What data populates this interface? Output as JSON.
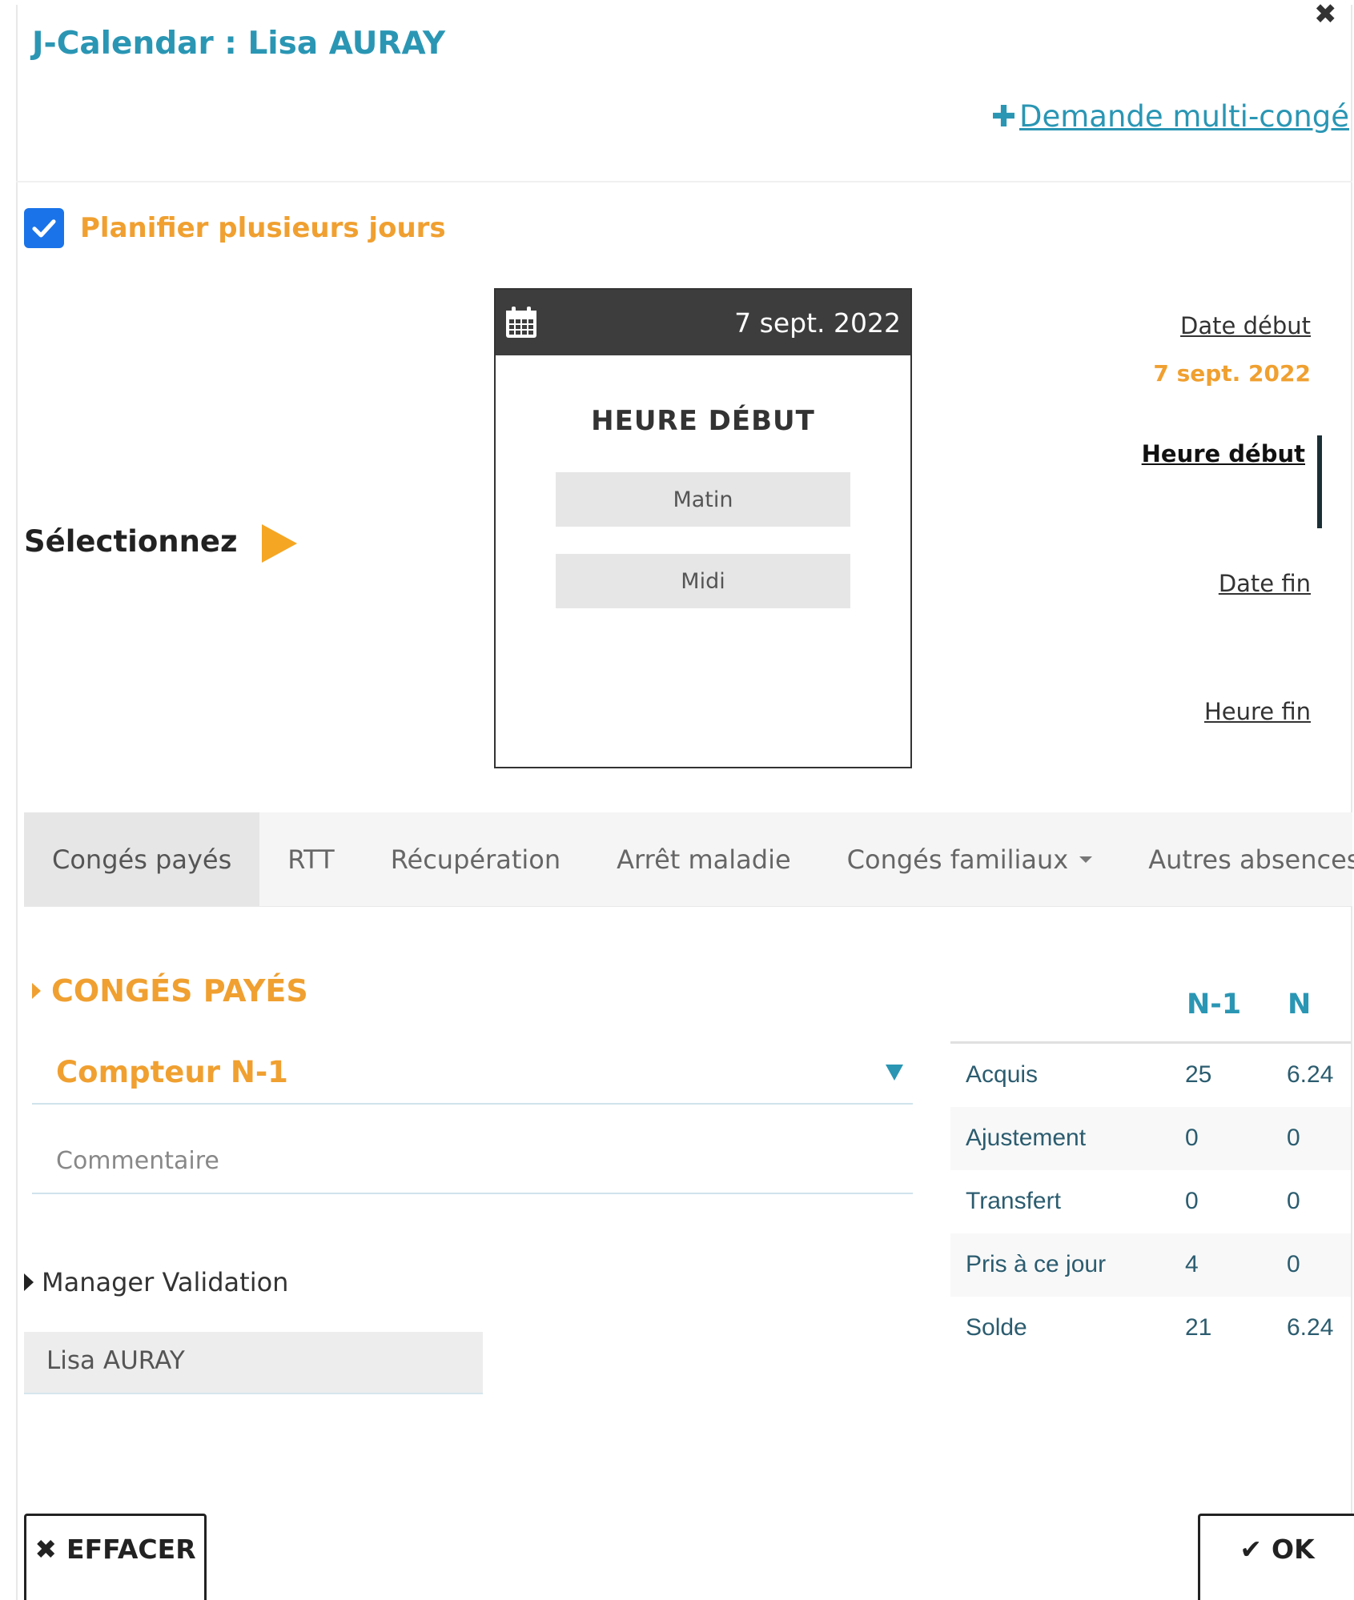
{
  "header": {
    "title": "J-Calendar : Lisa AURAY",
    "close_icon": "close-icon",
    "multi_leave_link": "Demande multi-congé",
    "multi_leave_icon": "plus-icon"
  },
  "plan_multiple_days": {
    "label": "Planifier plusieurs jours",
    "checked": true
  },
  "select_prompt": "Sélectionnez",
  "date_picker": {
    "date": "7 sept. 2022",
    "title": "HEURE DÉBUT",
    "options": [
      "Matin",
      "Midi"
    ]
  },
  "steps": {
    "start_date_label": "Date début",
    "start_date_value": "7 sept. 2022",
    "start_time_label": "Heure début",
    "end_date_label": "Date fin",
    "end_time_label": "Heure fin"
  },
  "tabs": [
    {
      "label": "Congés payés",
      "active": true
    },
    {
      "label": "RTT"
    },
    {
      "label": "Récupération"
    },
    {
      "label": "Arrêt maladie"
    },
    {
      "label": "Congés familiaux",
      "dropdown": true
    },
    {
      "label": "Autres absences",
      "dropdown": true
    }
  ],
  "leave_section": {
    "heading": "CONGÉS PAYÉS",
    "counter": "Compteur N-1",
    "comment_placeholder": "Commentaire"
  },
  "manager": {
    "heading": "Manager Validation",
    "name": "Lisa AURAY"
  },
  "balance": {
    "headers": [
      "N-1",
      "N"
    ],
    "rows": [
      {
        "label": "Acquis",
        "n_1": "25",
        "n": "6.24"
      },
      {
        "label": "Ajustement",
        "n_1": "0",
        "n": "0"
      },
      {
        "label": "Transfert",
        "n_1": "0",
        "n": "0"
      },
      {
        "label": "Pris à ce jour",
        "n_1": "4",
        "n": "0"
      },
      {
        "label": "Solde",
        "n_1": "21",
        "n": "6.24"
      }
    ]
  },
  "buttons": {
    "clear": "EFFACER",
    "ok": "OK"
  },
  "colors": {
    "accent_blue": "#2a96b4",
    "accent_orange": "#f0a030",
    "checkbox_blue": "#1a73e8",
    "picker_header": "#3d3d3d"
  }
}
